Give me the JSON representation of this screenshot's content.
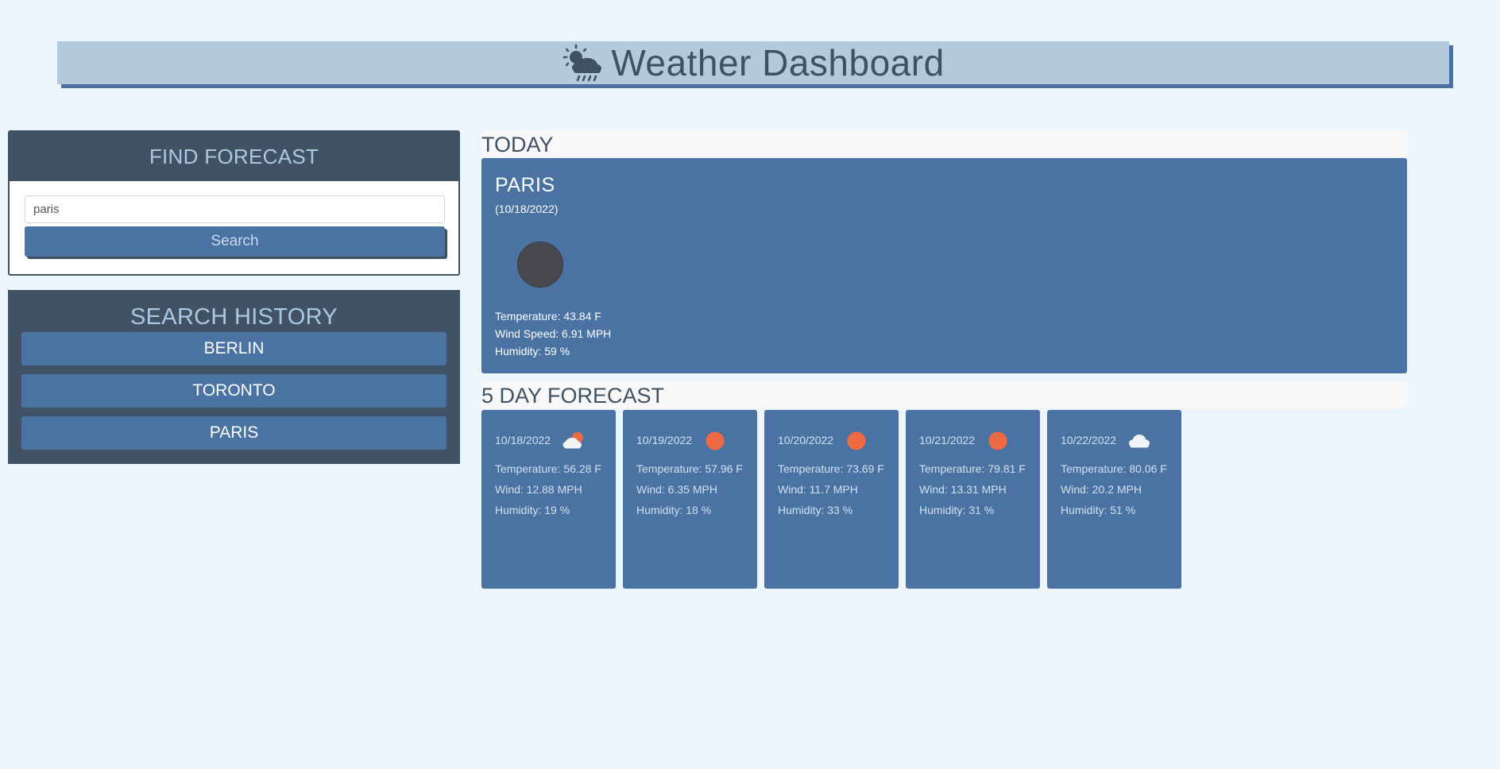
{
  "header": {
    "title": "Weather Dashboard",
    "icon": "sun-cloud-rain-icon"
  },
  "find": {
    "title": "FIND FORECAST",
    "input_value": "paris",
    "search_label": "Search"
  },
  "history": {
    "title": "SEARCH HISTORY",
    "items": [
      "BERLIN",
      "TORONTO",
      "PARIS"
    ]
  },
  "today": {
    "section_label": "TODAY",
    "city": "PARIS",
    "date": "(10/18/2022)",
    "icon": "weather-icon",
    "temperature": "Temperature: 43.84 F",
    "wind": "Wind Speed: 6.91 MPH",
    "humidity": "Humidity: 59 %"
  },
  "forecast": {
    "section_label": "5 DAY FORECAST",
    "days": [
      {
        "date": "10/18/2022",
        "icon": "partly-cloudy-icon",
        "temperature": "Temperature: 56.28 F",
        "wind": "Wind: 12.88 MPH",
        "humidity": "Humidity: 19 %"
      },
      {
        "date": "10/19/2022",
        "icon": "sun-icon",
        "temperature": "Temperature: 57.96 F",
        "wind": "Wind: 6.35 MPH",
        "humidity": "Humidity: 18 %"
      },
      {
        "date": "10/20/2022",
        "icon": "sun-icon",
        "temperature": "Temperature: 73.69 F",
        "wind": "Wind: 11.7 MPH",
        "humidity": "Humidity: 33 %"
      },
      {
        "date": "10/21/2022",
        "icon": "sun-icon",
        "temperature": "Temperature: 79.81 F",
        "wind": "Wind: 13.31 MPH",
        "humidity": "Humidity: 31 %"
      },
      {
        "date": "10/22/2022",
        "icon": "cloud-icon",
        "temperature": "Temperature: 80.06 F",
        "wind": "Wind: 20.2 MPH",
        "humidity": "Humidity: 51 %"
      }
    ]
  },
  "colors": {
    "background": "#eef6fd",
    "header_bg": "#b3cadc",
    "accent_blue": "#4a73a4",
    "panel_dark": "#415264",
    "sun_orange": "#ee6a43"
  }
}
